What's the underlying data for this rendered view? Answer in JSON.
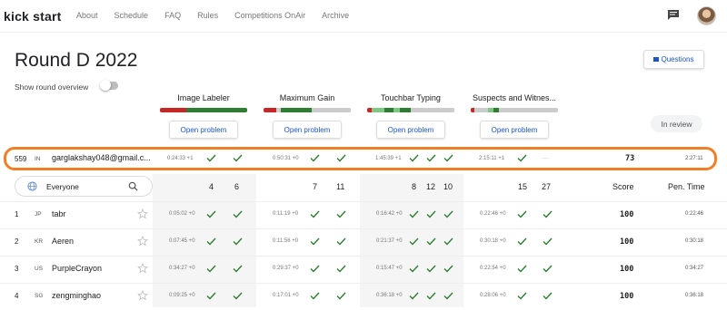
{
  "nav": {
    "logo": "kick start",
    "links": [
      "About",
      "Schedule",
      "FAQ",
      "Rules",
      "Competitions OnAir",
      "Archive"
    ]
  },
  "page": {
    "title": "Round D 2022",
    "questions_label": "Questions",
    "overview_label": "Show round overview",
    "in_review_label": "In review"
  },
  "problems": [
    {
      "name": "Image Labeler",
      "button": "Open problem",
      "bar": [
        {
          "c": "#c62828",
          "w": 30
        },
        {
          "c": "#2e7d32",
          "w": 70
        }
      ]
    },
    {
      "name": "Maximum Gain",
      "button": "Open problem",
      "bar": [
        {
          "c": "#c62828",
          "w": 15
        },
        {
          "c": "#ccc",
          "w": 5
        },
        {
          "c": "#2e7d32",
          "w": 35
        },
        {
          "c": "#ccc",
          "w": 45
        }
      ]
    },
    {
      "name": "Touchbar Typing",
      "button": "Open problem",
      "bar": [
        {
          "c": "#c62828",
          "w": 5
        },
        {
          "c": "#81c784",
          "w": 15
        },
        {
          "c": "#2e7d32",
          "w": 10
        },
        {
          "c": "#81c784",
          "w": 8
        },
        {
          "c": "#2e7d32",
          "w": 12
        },
        {
          "c": "#ccc",
          "w": 50
        }
      ]
    },
    {
      "name": "Suspects and Witnes...",
      "button": "Open problem",
      "bar": [
        {
          "c": "#c62828",
          "w": 4
        },
        {
          "c": "#ccc",
          "w": 16
        },
        {
          "c": "#81c784",
          "w": 6
        },
        {
          "c": "#2e7d32",
          "w": 6
        },
        {
          "c": "#ccc",
          "w": 68
        }
      ]
    }
  ],
  "my_row": {
    "rank": "559",
    "country": "IN",
    "name": "garglakshay048@gmail.c...",
    "times": [
      "0:24:33 +1",
      "0:50:31 +0",
      "1:45:39 +1",
      "2:15:11 +1"
    ],
    "dash": "---",
    "score": "73",
    "penalty": "2:27:11"
  },
  "filter": {
    "value": "Everyone"
  },
  "header": {
    "points": [
      "4",
      "6",
      "7",
      "11",
      "8",
      "12",
      "10",
      "15",
      "27"
    ],
    "score": "Score",
    "pen_time": "Pen. Time"
  },
  "rows": [
    {
      "rank": "1",
      "country": "JP",
      "name": "tabr",
      "times": [
        "0:05:02 +0",
        "0:11:19 +0",
        "0:16:42 +0",
        "0:22:46 +0"
      ],
      "score": "100",
      "penalty": "0:22:46"
    },
    {
      "rank": "2",
      "country": "KR",
      "name": "Aeren",
      "times": [
        "0:07:45 +0",
        "0:11:56 +0",
        "0:21:37 +0",
        "0:30:18 +0"
      ],
      "score": "100",
      "penalty": "0:30:18"
    },
    {
      "rank": "3",
      "country": "US",
      "name": "PurpleCrayon",
      "times": [
        "0:34:27 +0",
        "0:29:37 +0",
        "0:15:47 +0",
        "0:22:54 +0"
      ],
      "score": "100",
      "penalty": "0:34:27"
    },
    {
      "rank": "4",
      "country": "SG",
      "name": "zengminghao",
      "times": [
        "0:09:25 +0",
        "0:17:01 +0",
        "0:36:18 +0",
        "0:28:06 +0"
      ],
      "score": "100",
      "penalty": "0:36:18"
    }
  ],
  "colors": {
    "accent": "#1a56c4",
    "check": "#2e7d32",
    "highlight": "#f07f26"
  }
}
